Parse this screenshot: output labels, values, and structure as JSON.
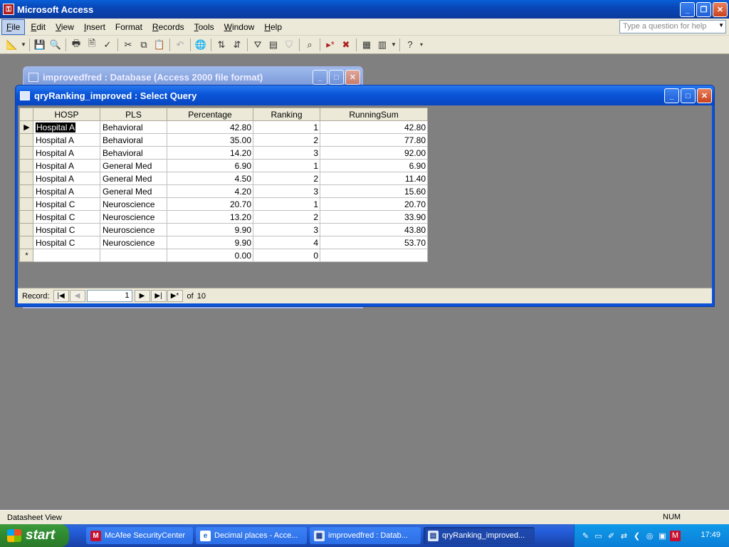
{
  "app": {
    "title": "Microsoft Access"
  },
  "menu": {
    "items": [
      {
        "key": "F",
        "rest": "ile"
      },
      {
        "key": "E",
        "rest": "dit"
      },
      {
        "key": "V",
        "rest": "iew"
      },
      {
        "key": "I",
        "rest": "nsert"
      },
      {
        "key": "",
        "rest": "Format"
      },
      {
        "key": "R",
        "rest": "ecords"
      },
      {
        "key": "T",
        "rest": "ools"
      },
      {
        "key": "W",
        "rest": "indow"
      },
      {
        "key": "H",
        "rest": "elp"
      }
    ],
    "help_placeholder": "Type a question for help"
  },
  "db_window": {
    "title": "improvedfred : Database (Access 2000 file format)"
  },
  "query_window": {
    "title": "qryRanking_improved : Select Query",
    "columns": [
      "HOSP",
      "PLS",
      "Percentage",
      "Ranking",
      "RunningSum"
    ],
    "rows": [
      [
        "Hospital A",
        "Behavioral",
        "42.80",
        "1",
        "42.80"
      ],
      [
        "Hospital A",
        "Behavioral",
        "35.00",
        "2",
        "77.80"
      ],
      [
        "Hospital A",
        "Behavioral",
        "14.20",
        "3",
        "92.00"
      ],
      [
        "Hospital A",
        "General Med",
        "6.90",
        "1",
        "6.90"
      ],
      [
        "Hospital A",
        "General Med",
        "4.50",
        "2",
        "11.40"
      ],
      [
        "Hospital A",
        "General Med",
        "4.20",
        "3",
        "15.60"
      ],
      [
        "Hospital C",
        "Neuroscience",
        "20.70",
        "1",
        "20.70"
      ],
      [
        "Hospital C",
        "Neuroscience",
        "13.20",
        "2",
        "33.90"
      ],
      [
        "Hospital C",
        "Neuroscience",
        "9.90",
        "3",
        "43.80"
      ],
      [
        "Hospital C",
        "Neuroscience",
        "9.90",
        "4",
        "53.70"
      ]
    ],
    "new_row": [
      "",
      "",
      "0.00",
      "0",
      ""
    ],
    "new_row_marker": "*",
    "current_row_marker": "▶",
    "record_nav": {
      "label": "Record:",
      "current": "1",
      "of_label": "of",
      "total": "10"
    }
  },
  "status": {
    "left": "Datasheet View",
    "right": "NUM"
  },
  "taskbar": {
    "start": "start",
    "tasks": [
      {
        "label": "McAfee SecurityCenter",
        "icon": "mcafee-icon"
      },
      {
        "label": "Decimal places - Acce...",
        "icon": "ie-icon"
      },
      {
        "label": "improvedfred : Datab...",
        "icon": "database-icon"
      },
      {
        "label": "qryRanking_improved...",
        "icon": "query-icon"
      }
    ],
    "clock": "17:49"
  }
}
